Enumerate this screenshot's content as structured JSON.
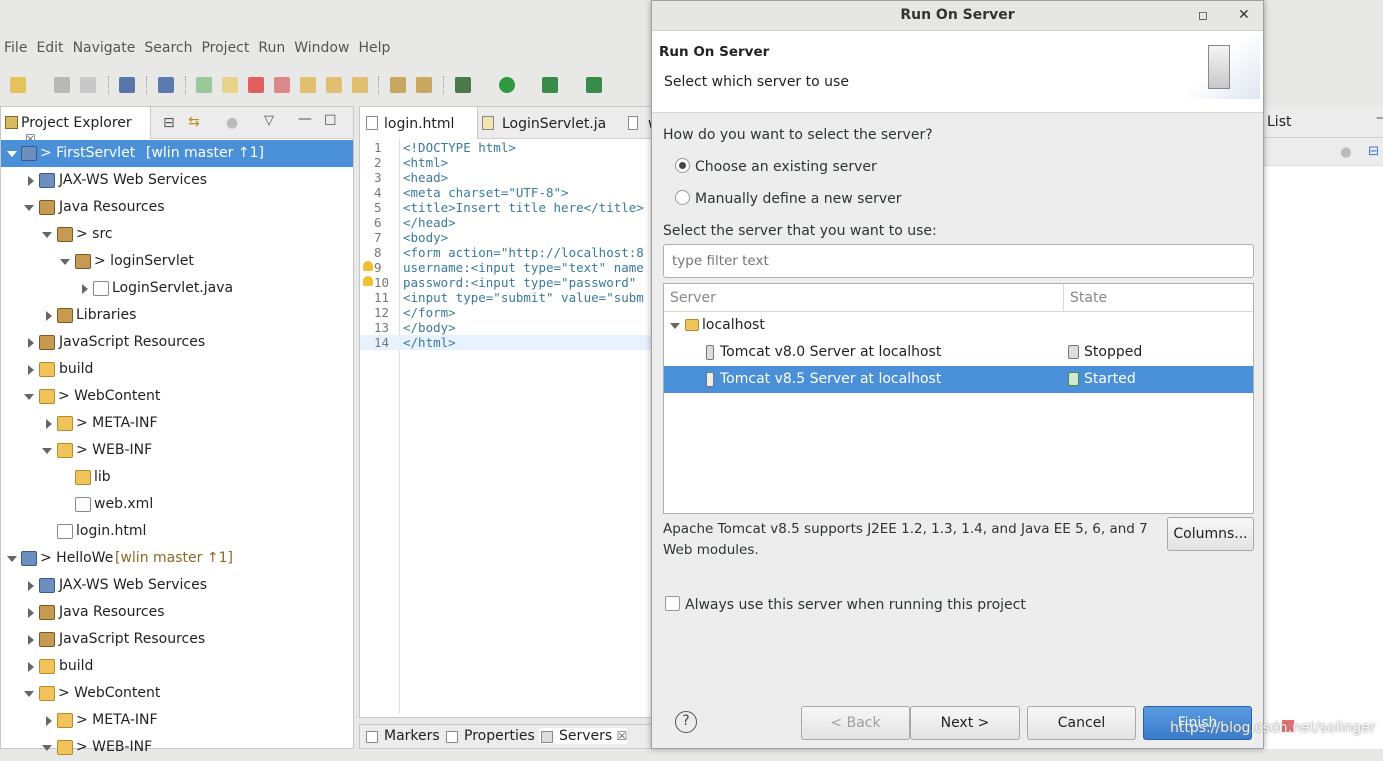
{
  "menu": [
    "File",
    "Edit",
    "Navigate",
    "Search",
    "Project",
    "Run",
    "Window",
    "Help"
  ],
  "project_explorer": {
    "tab_label": "Project Explorer",
    "items": [
      {
        "label": "> FirstServlet",
        "suffix": "[wlin master ↑1]",
        "icon": "project-icon"
      },
      {
        "label": "JAX-WS Web Services",
        "icon": "webservice-icon"
      },
      {
        "label": "Java Resources",
        "icon": "java-resources-icon"
      },
      {
        "label": "> src",
        "icon": "package-folder-icon"
      },
      {
        "label": "> loginServlet",
        "icon": "package-icon"
      },
      {
        "label": "LoginServlet.java",
        "icon": "java-file-icon"
      },
      {
        "label": "Libraries",
        "icon": "library-icon"
      },
      {
        "label": "JavaScript Resources",
        "icon": "js-resources-icon"
      },
      {
        "label": "build",
        "icon": "folder-icon"
      },
      {
        "label": "> WebContent",
        "icon": "folder-icon"
      },
      {
        "label": "> META-INF",
        "icon": "folder-icon"
      },
      {
        "label": "> WEB-INF",
        "icon": "folder-icon"
      },
      {
        "label": "lib",
        "icon": "folder-icon"
      },
      {
        "label": "web.xml",
        "icon": "xml-file-icon"
      },
      {
        "label": "login.html",
        "icon": "html-file-icon"
      },
      {
        "label": "> HelloWe",
        "suffix": "[wlin master ↑1]",
        "icon": "project-icon"
      },
      {
        "label": "JAX-WS Web Services",
        "icon": "webservice-icon"
      },
      {
        "label": "Java Resources",
        "icon": "java-resources-icon"
      },
      {
        "label": "JavaScript Resources",
        "icon": "js-resources-icon"
      },
      {
        "label": "build",
        "icon": "folder-icon"
      },
      {
        "label": "> WebContent",
        "icon": "folder-icon"
      },
      {
        "label": "> META-INF",
        "icon": "folder-icon"
      },
      {
        "label": "> WEB-INF",
        "icon": "folder-icon"
      }
    ]
  },
  "editor": {
    "tabs": [
      "login.html",
      "LoginServlet.ja",
      "w"
    ],
    "lines": [
      {
        "n": "1",
        "code": "<!DOCTYPE html>"
      },
      {
        "n": "2",
        "code": "<html>"
      },
      {
        "n": "3",
        "code": "<head>"
      },
      {
        "n": "4",
        "code": "<meta charset=\"UTF-8\">"
      },
      {
        "n": "5",
        "code": "<title>Insert title here</title>"
      },
      {
        "n": "6",
        "code": "</head>"
      },
      {
        "n": "7",
        "code": "<body>"
      },
      {
        "n": "8",
        "code": "<form action=\"http://localhost:8"
      },
      {
        "n": "9",
        "code": "username:<input type=\"text\" name"
      },
      {
        "n": "10",
        "code": "password:<input type=\"password\""
      },
      {
        "n": "11",
        "code": "<input type=\"submit\" value=\"subm"
      },
      {
        "n": "12",
        "code": "</form>"
      },
      {
        "n": "13",
        "code": "</body>"
      },
      {
        "n": "14",
        "code": "</html>"
      }
    ]
  },
  "bottom_tabs": [
    "Markers",
    "Properties",
    "Servers"
  ],
  "right_panel": {
    "tab_label": "List"
  },
  "dialog": {
    "window_title": "Run On Server",
    "heading": "Run On Server",
    "subheading": "Select which server to use",
    "question": "How do you want to select the server?",
    "radio_existing": "Choose an existing server",
    "radio_manual": "Manually define a new server",
    "select_label": "Select the server that you want to use:",
    "filter_placeholder": "type filter text",
    "columns": [
      "Server",
      "State"
    ],
    "host": "localhost",
    "servers": [
      {
        "name": "Tomcat v8.0 Server at localhost",
        "state": "Stopped"
      },
      {
        "name": "Tomcat v8.5 Server at localhost",
        "state": "Started"
      }
    ],
    "description": "Apache Tomcat v8.5 supports J2EE 1.2, 1.3, 1.4, and Java EE 5, 6, and 7 Web modules.",
    "columns_button": "Columns...",
    "always_use_label": "Always use this server when running this project",
    "buttons": {
      "back": "< Back",
      "next": "Next >",
      "cancel": "Cancel",
      "finish": "Finish"
    },
    "help_symbol": "?"
  },
  "watermark": "https://blog.csdn.net/solinger"
}
